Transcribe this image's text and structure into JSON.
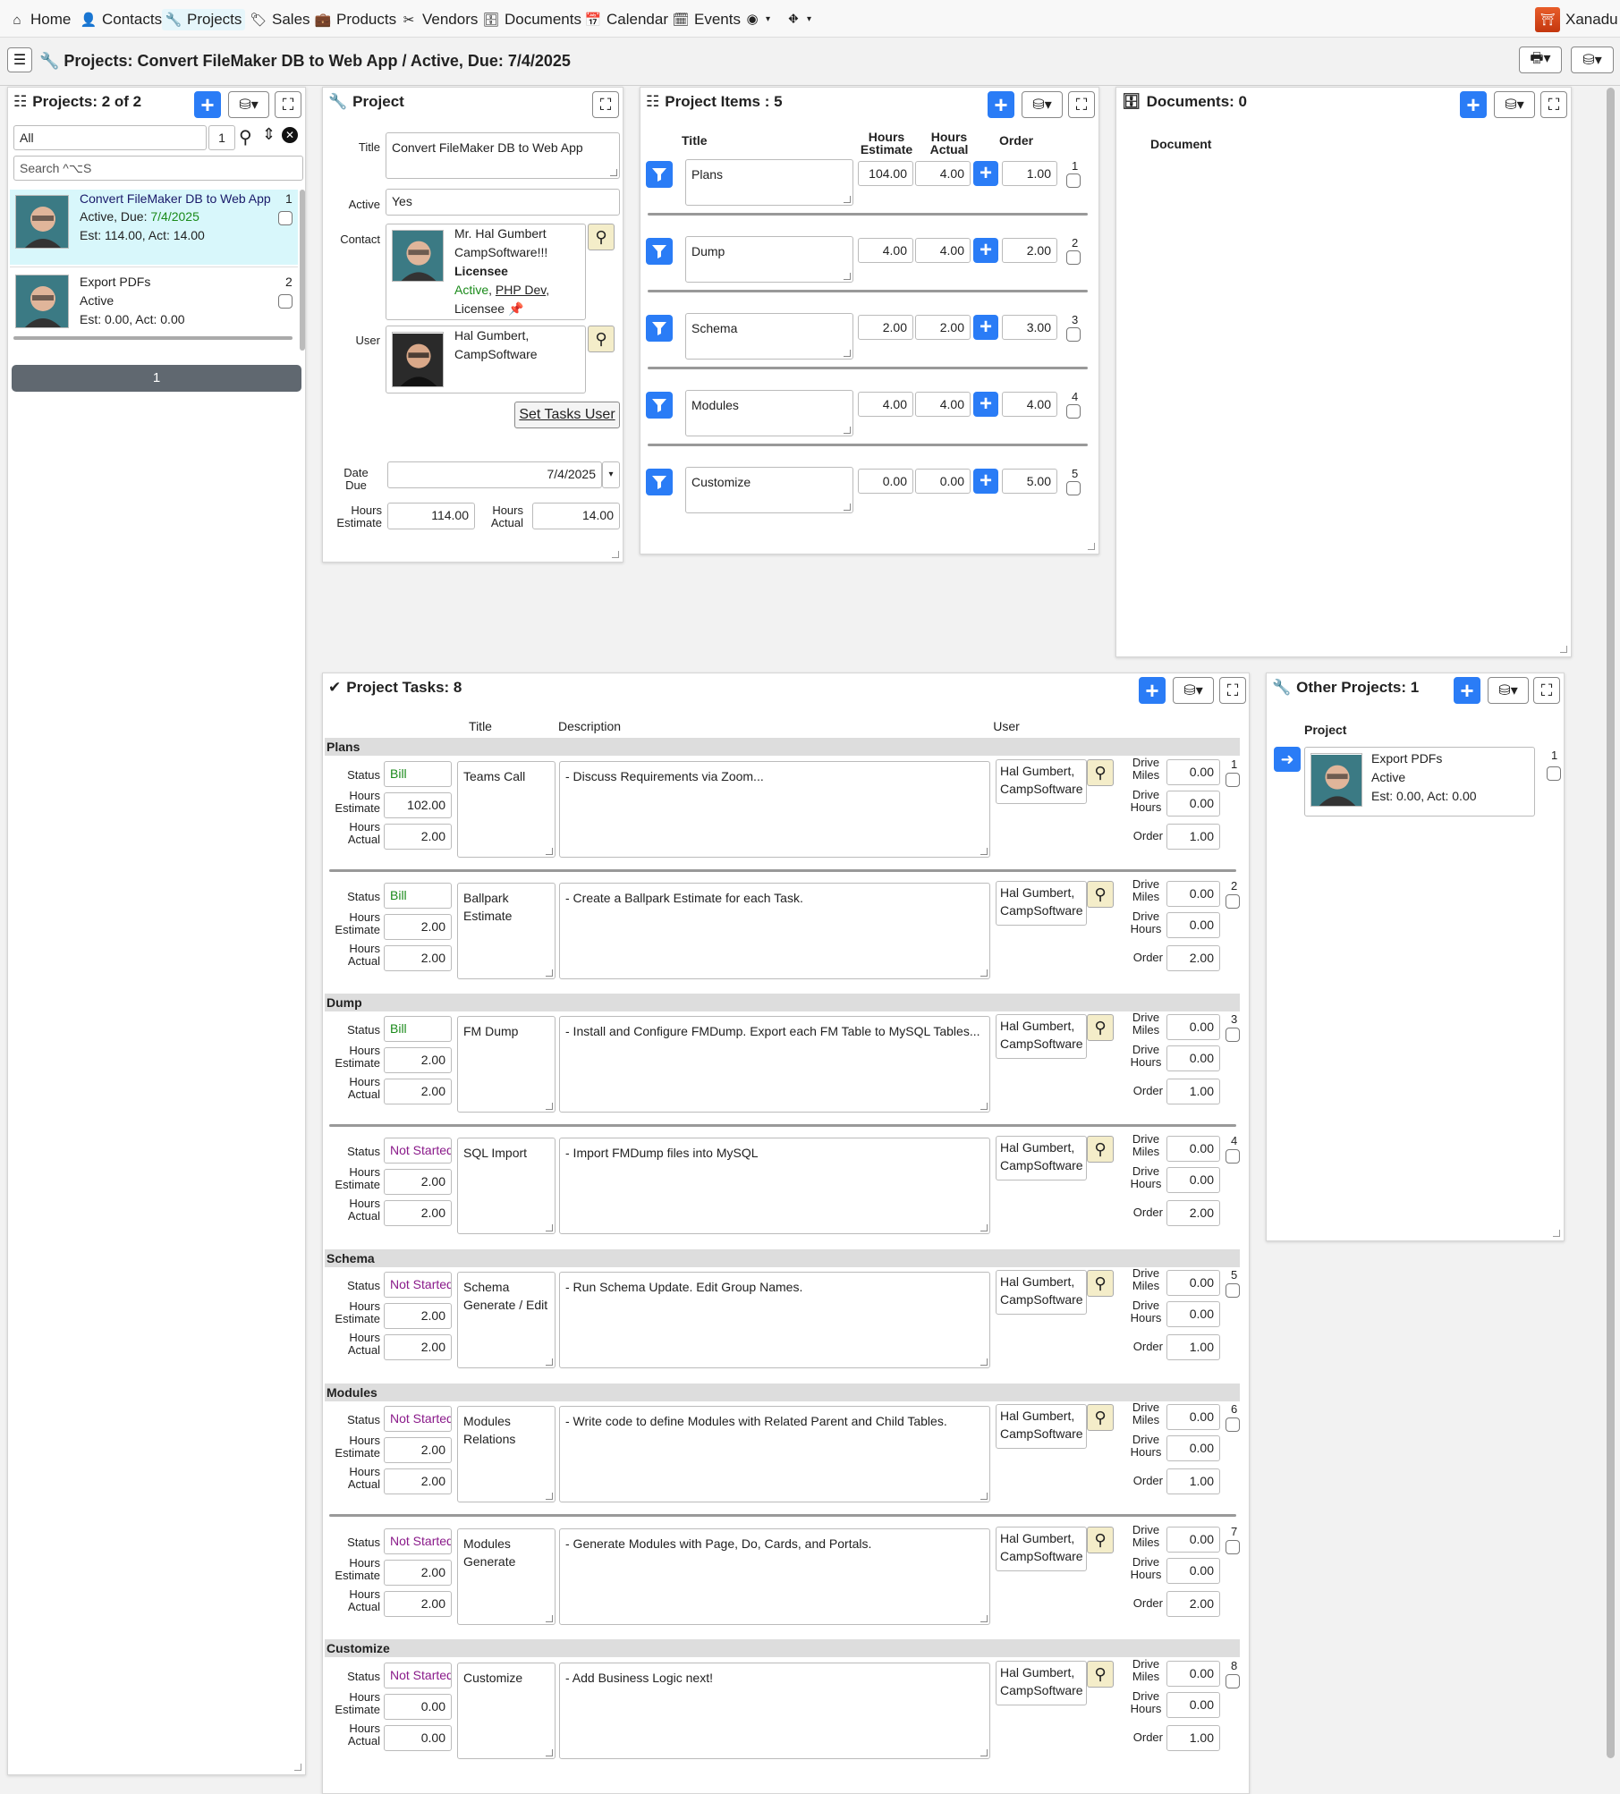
{
  "nav": {
    "items": [
      "Home",
      "Contacts",
      "Projects",
      "Sales",
      "Products",
      "Vendors",
      "Documents",
      "Calendar",
      "Events"
    ],
    "user": "Xanadu"
  },
  "page": {
    "title": "Projects: Convert FileMaker DB to Web App / Active, Due: 7/4/2025"
  },
  "list": {
    "title": "Projects: 2 of 2",
    "filter": "All",
    "page_size": "1",
    "search_placeholder": "Search ^⌥S",
    "pager": "1",
    "items": [
      {
        "title": "Convert FileMaker DB to Web App",
        "num": "1",
        "status": "Active, Due: ",
        "due": "7/4/2025",
        "est": "Est: 114.00, Act: 14.00"
      },
      {
        "title": "Export PDFs",
        "num": "2",
        "status": "Active",
        "est": "Est: 0.00, Act: 0.00"
      }
    ]
  },
  "project": {
    "title": "Project",
    "title_label": "Title",
    "title_value": "Convert FileMaker DB to Web App",
    "active_label": "Active",
    "active_value": "Yes",
    "contact_label": "Contact",
    "contact_name": "Mr. Hal Gumbert",
    "contact_company": "CampSoftware!!!",
    "contact_role": "Licensee",
    "contact_active": "Active",
    "contact_sep": ", ",
    "contact_link": "PHP Dev",
    "contact_comma": ",",
    "contact_tag": "Licensee",
    "user_label": "User",
    "user_name": "Hal Gumbert,",
    "user_company": "CampSoftware",
    "set_tasks_user": "Set Tasks User",
    "date_due_label": "Date\nDue",
    "date_due": "7/4/2025",
    "hours_est_label": "Hours\nEstimate",
    "hours_est": "114.00",
    "hours_act_label": "Hours\nActual",
    "hours_act": "14.00"
  },
  "items": {
    "title": "Project Items : 5",
    "col_title": "Title",
    "col_est": "Hours\nEstimate",
    "col_act": "Hours\nActual",
    "col_order": "Order",
    "rows": [
      {
        "title": "Plans",
        "est": "104.00",
        "act": "4.00",
        "order": "1.00",
        "num": "1"
      },
      {
        "title": "Dump",
        "est": "4.00",
        "act": "4.00",
        "order": "2.00",
        "num": "2"
      },
      {
        "title": "Schema",
        "est": "2.00",
        "act": "2.00",
        "order": "3.00",
        "num": "3"
      },
      {
        "title": "Modules",
        "est": "4.00",
        "act": "4.00",
        "order": "4.00",
        "num": "4"
      },
      {
        "title": "Customize",
        "est": "0.00",
        "act": "0.00",
        "order": "5.00",
        "num": "5"
      }
    ]
  },
  "docs": {
    "title": "Documents: 0",
    "col": "Document"
  },
  "tasks": {
    "title": "Project Tasks: 8",
    "col_title": "Title",
    "col_desc": "Description",
    "col_user": "User",
    "status_label": "Status",
    "est_label": "Hours\nEstimate",
    "act_label": "Hours\nActual",
    "miles_label": "Drive\nMiles",
    "dhours_label": "Drive\nHours",
    "order_label": "Order",
    "groups": [
      {
        "name": "Plans"
      },
      {
        "name": "Dump"
      },
      {
        "name": "Schema"
      },
      {
        "name": "Modules"
      },
      {
        "name": "Customize"
      }
    ],
    "rows": [
      {
        "status": "Bill",
        "est": "102.00",
        "act": "2.00",
        "title": "Teams Call",
        "desc": "- Discuss Requirements via Zoom...",
        "user": "Hal Gumbert,",
        "company": "CampSoftware",
        "miles": "0.00",
        "dhours": "0.00",
        "order": "1.00",
        "num": "1"
      },
      {
        "status": "Bill",
        "est": "2.00",
        "act": "2.00",
        "title": "Ballpark Estimate",
        "desc": "- Create a Ballpark Estimate for each Task.",
        "user": "Hal Gumbert,",
        "company": "CampSoftware",
        "miles": "0.00",
        "dhours": "0.00",
        "order": "2.00",
        "num": "2"
      },
      {
        "status": "Bill",
        "est": "2.00",
        "act": "2.00",
        "title": "FM Dump",
        "desc": "- Install and Configure FMDump. Export each FM Table to MySQL Tables...",
        "user": "Hal Gumbert,",
        "company": "CampSoftware",
        "miles": "0.00",
        "dhours": "0.00",
        "order": "1.00",
        "num": "3"
      },
      {
        "status": "Not Started",
        "est": "2.00",
        "act": "2.00",
        "title": "SQL Import",
        "desc": "- Import FMDump files into MySQL",
        "user": "Hal Gumbert,",
        "company": "CampSoftware",
        "miles": "0.00",
        "dhours": "0.00",
        "order": "2.00",
        "num": "4"
      },
      {
        "status": "Not Started",
        "est": "2.00",
        "act": "2.00",
        "title": "Schema Generate / Edit",
        "desc": "- Run Schema Update. Edit Group Names.",
        "user": "Hal Gumbert,",
        "company": "CampSoftware",
        "miles": "0.00",
        "dhours": "0.00",
        "order": "1.00",
        "num": "5"
      },
      {
        "status": "Not Started",
        "est": "2.00",
        "act": "2.00",
        "title": "Modules Relations",
        "desc": "- Write code to define Modules with Related Parent and Child Tables.",
        "user": "Hal Gumbert,",
        "company": "CampSoftware",
        "miles": "0.00",
        "dhours": "0.00",
        "order": "1.00",
        "num": "6"
      },
      {
        "status": "Not Started",
        "est": "2.00",
        "act": "2.00",
        "title": "Modules Generate",
        "desc": "- Generate Modules with Page, Do, Cards, and Portals.",
        "user": "Hal Gumbert,",
        "company": "CampSoftware",
        "miles": "0.00",
        "dhours": "0.00",
        "order": "2.00",
        "num": "7"
      },
      {
        "status": "Not Started",
        "est": "0.00",
        "act": "0.00",
        "title": "Customize",
        "desc": "- Add Business Logic next!",
        "user": "Hal Gumbert,",
        "company": "CampSoftware",
        "miles": "0.00",
        "dhours": "0.00",
        "order": "1.00",
        "num": "8"
      }
    ]
  },
  "other": {
    "title": "Other Projects: 1",
    "col": "Project",
    "item": {
      "title": "Export PDFs",
      "status": "Active",
      "est": "Est: 0.00, Act: 0.00",
      "num": "1"
    }
  },
  "colors": {
    "accent": "#2a7cf6",
    "green": "#1a8a1a",
    "purple": "#8a1a8a",
    "group_bg": "#dddddd"
  }
}
